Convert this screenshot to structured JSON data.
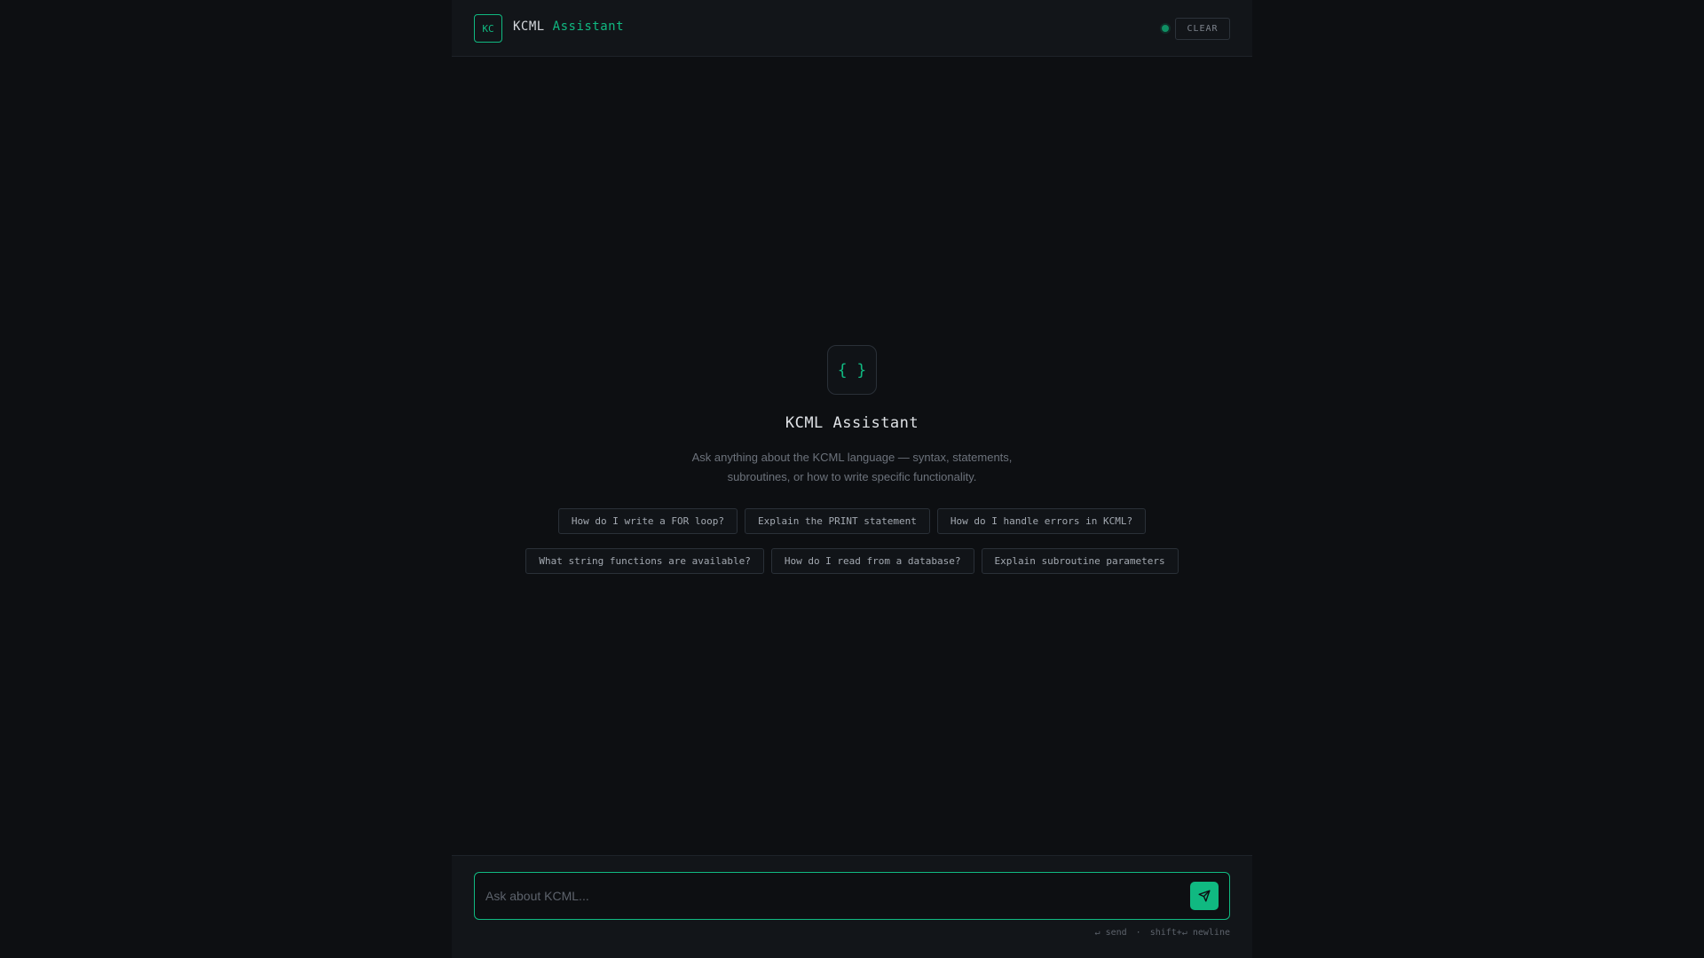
{
  "header": {
    "logo_text": "KC",
    "brand_primary": "KCML",
    "brand_accent": "Assistant",
    "status": "online",
    "clear_label": "CLEAR"
  },
  "empty_state": {
    "icon_glyph": "{ }",
    "title": "KCML Assistant",
    "description": "Ask anything about the KCML language — syntax, statements, subroutines, or how to write specific functionality.",
    "suggestions_row1": [
      "How do I write a FOR loop?",
      "Explain the PRINT statement",
      "How do I handle errors in KCML?"
    ],
    "suggestions_row2": [
      "What string functions are available?",
      "How do I read from a database?",
      "Explain subroutine parameters"
    ]
  },
  "composer": {
    "placeholder": "Ask about KCML...",
    "send_icon": "send-icon",
    "hint_send": "↵ send",
    "hint_separator": "·",
    "hint_newline": "shift+↵ newline"
  },
  "colors": {
    "accent": "#10b981",
    "background": "#0d0f12",
    "panel": "#121519"
  }
}
